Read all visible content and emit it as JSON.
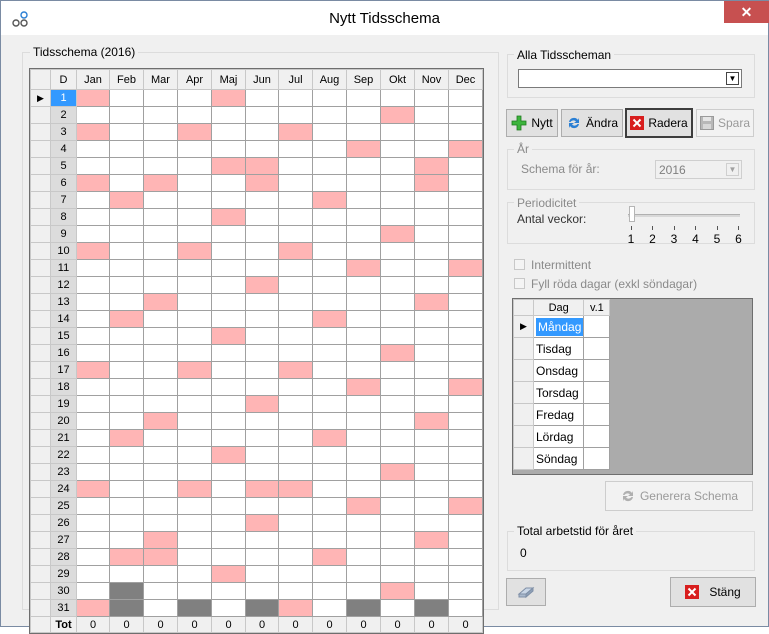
{
  "window": {
    "title": "Nytt Tidsschema",
    "close_label": "✕"
  },
  "schedule": {
    "group_title": "Tidsschema (2016)",
    "day_header": "D",
    "months": [
      "Jan",
      "Feb",
      "Mar",
      "Apr",
      "Maj",
      "Jun",
      "Jul",
      "Aug",
      "Sep",
      "Okt",
      "Nov",
      "Dec"
    ],
    "total_label": "Tot",
    "totals": [
      "0",
      "0",
      "0",
      "0",
      "0",
      "0",
      "0",
      "0",
      "0",
      "0",
      "0",
      "0"
    ],
    "current_row": 1,
    "row_indicator": "▶",
    "rows": [
      {
        "day": "1",
        "cells": "P...P......."
      },
      {
        "day": "2",
        "cells": ".........P.."
      },
      {
        "day": "3",
        "cells": "P..P..P....."
      },
      {
        "day": "4",
        "cells": "........P..P"
      },
      {
        "day": "5",
        "cells": "....PP....P."
      },
      {
        "day": "6",
        "cells": "P.P..P....P."
      },
      {
        "day": "7",
        "cells": ".P.....P...."
      },
      {
        "day": "8",
        "cells": "....P......."
      },
      {
        "day": "9",
        "cells": ".........P.."
      },
      {
        "day": "10",
        "cells": "P..P..P....."
      },
      {
        "day": "11",
        "cells": "........P..P"
      },
      {
        "day": "12",
        "cells": ".....P......"
      },
      {
        "day": "13",
        "cells": "..P.......P."
      },
      {
        "day": "14",
        "cells": ".P.....P...."
      },
      {
        "day": "15",
        "cells": "....P......."
      },
      {
        "day": "16",
        "cells": ".........P.."
      },
      {
        "day": "17",
        "cells": "P..P..P....."
      },
      {
        "day": "18",
        "cells": "........P..P"
      },
      {
        "day": "19",
        "cells": ".....P......"
      },
      {
        "day": "20",
        "cells": "..P.......P."
      },
      {
        "day": "21",
        "cells": ".P.....P...."
      },
      {
        "day": "22",
        "cells": "....P......."
      },
      {
        "day": "23",
        "cells": ".........P.."
      },
      {
        "day": "24",
        "cells": "P..P.PP....."
      },
      {
        "day": "25",
        "cells": "........P..P"
      },
      {
        "day": "26",
        "cells": ".....P......"
      },
      {
        "day": "27",
        "cells": "..P.......P."
      },
      {
        "day": "28",
        "cells": ".PP....P...."
      },
      {
        "day": "29",
        "cells": "....P......."
      },
      {
        "day": "30",
        "cells": ".G.......P.."
      },
      {
        "day": "31",
        "cells": "PG.G.GP.G.G."
      }
    ]
  },
  "all_schedules": {
    "group_title": "Alla Tidsscheman",
    "selected": ""
  },
  "toolbar": {
    "new_label": "Nytt",
    "edit_label": "Ändra",
    "delete_label": "Radera",
    "save_label": "Spara"
  },
  "year": {
    "group_title": "År",
    "label": "Schema för år:",
    "value": "2016"
  },
  "periodicity": {
    "group_title": "Periodicitet",
    "weeks_label": "Antal veckor:",
    "ticks": [
      "1",
      "2",
      "3",
      "4",
      "5",
      "6"
    ],
    "value": 1,
    "intermittent_label": "Intermittent",
    "fill_red_days_label": "Fyll röda dagar (exkl söndagar)"
  },
  "week_table": {
    "headers": [
      "Dag",
      "v.1"
    ],
    "row_indicator": "▶",
    "days": [
      "Måndag",
      "Tisdag",
      "Onsdag",
      "Torsdag",
      "Fredag",
      "Lördag",
      "Söndag"
    ]
  },
  "generate_label": "Generera Schema",
  "total": {
    "group_title": "Total arbetstid för året",
    "value": "0"
  },
  "close_button_label": "Stäng",
  "colors": {
    "red_day": "#ffb5b5",
    "nonexistent_day": "#808080",
    "selection": "#3399ff",
    "close_bg": "#c75050"
  }
}
